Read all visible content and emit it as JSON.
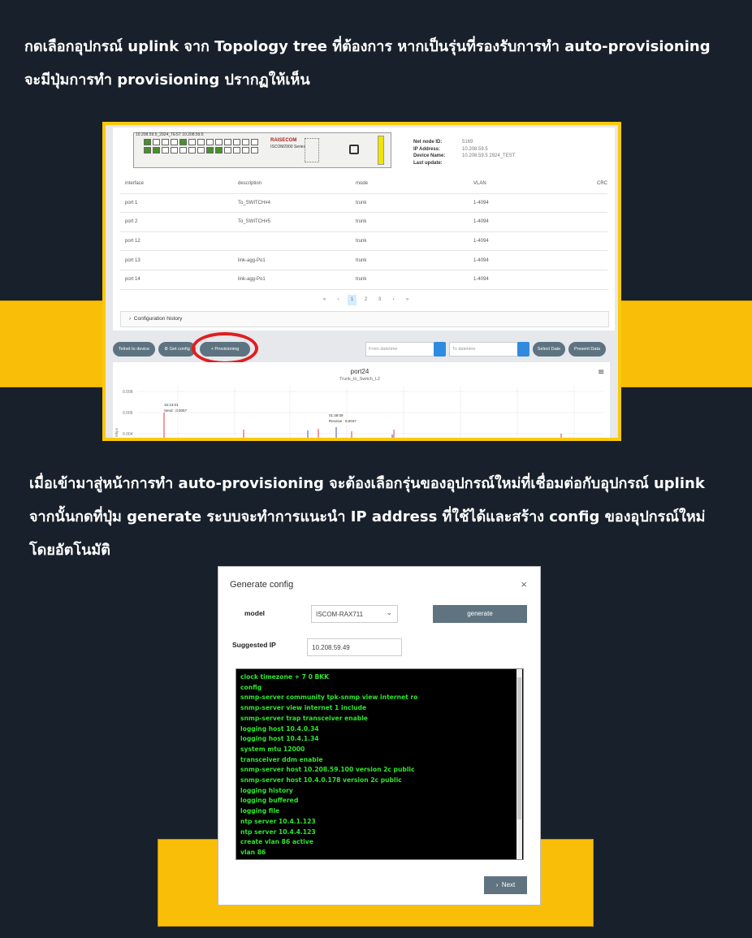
{
  "paragraph1": {
    "line1": "กดเลือกอุปกรณ์ uplink จาก Topology tree ที่ต้องการ หากเป็นรุ่นที่รองรับการทำ auto-provisioning",
    "line2": "จะมีปุ่มการทำ provisioning ปรากฏให้เห็น"
  },
  "paragraph2": {
    "line1": "เมื่อเข้ามาสู่หน้าการทำ auto-provisioning จะต้องเลือกรุ่นของอุปกรณ์ใหม่ที่เชื่อมต่อกับอุปกรณ์ uplink",
    "line2": "จากนั้นกดที่ปุ่ม generate ระบบจะทำการแนะนำ IP address ที่ใช้ได้และสร้าง config ของอุปกรณ์ใหม่",
    "line3": "โดยอัตโนมัติ"
  },
  "colors": {
    "background": "#18202b",
    "band": "#f9be08",
    "highlight_circle": "#e01e1e",
    "terminal_text": "#2fe52f",
    "button": "#5f7480"
  },
  "screenshot1": {
    "device_label": "10.208.59.5_2924_TEST 10.208.59.5",
    "brand": "RAISECOM",
    "series": "ISCOM2900 Series",
    "info": [
      {
        "key": "Net node ID:",
        "value": "5169"
      },
      {
        "key": "IP Address:",
        "value": "10.208.59.5"
      },
      {
        "key": "Device Name:",
        "value": "10.208.59.5 2924_TEST"
      },
      {
        "key": "Last update:",
        "value": ""
      }
    ],
    "table": {
      "headers": [
        "interface",
        "description",
        "mode",
        "VLAN",
        "CRC"
      ],
      "rows": [
        [
          "port 1",
          "To_SWITCH#4",
          "trunk",
          "1-4094",
          ""
        ],
        [
          "port 2",
          "To_SWITCH#5",
          "trunk",
          "1-4094",
          ""
        ],
        [
          "port 12",
          "",
          "trunk",
          "1-4094",
          ""
        ],
        [
          "port 13",
          "link-agg-Po1",
          "trunk",
          "1-4094",
          ""
        ],
        [
          "port 14",
          "link-agg-Po1",
          "trunk",
          "1-4094",
          ""
        ]
      ]
    },
    "pager": [
      "«",
      "‹",
      "1",
      "2",
      "3",
      "›",
      "»"
    ],
    "config_history": "Configuration history",
    "buttons": {
      "telnet": "Telnet to device",
      "get_config": "Get config",
      "provisioning": "+ Provisioning",
      "select_date": "Select Date",
      "present_data": "Present Data"
    },
    "from_placeholder": "From datetime",
    "to_placeholder": "To datetime",
    "chart": {
      "title": "port24",
      "subtitle": "Trunk_to_Switch_L2",
      "yticks": [
        "0.008",
        "0.006",
        "0.004"
      ],
      "ylabel": "Mbps",
      "tooltip1": {
        "time": "16:13:01",
        "text": "Send : 0.0057"
      },
      "tooltip2": {
        "time": "01:48:09",
        "text": "Receive : 0.0047"
      }
    }
  },
  "screenshot2": {
    "title": "Generate config",
    "close": "×",
    "model_label": "model",
    "model_value": "ISCOM-RAX711",
    "generate_label": "generate",
    "ip_label": "Suggested IP",
    "ip_value": "10.208.59.49",
    "config_lines": [
      "clock timezone + 7 0 BKK",
      "config",
      "snmp-server community tpk-snmp view internet ro",
      "snmp-server view internet 1 include",
      "snmp-server trap transceiver enable",
      "logging host 10.4.0.34",
      "logging host 10.4.1.34",
      "system mtu 12000",
      "transceiver ddm enable",
      "snmp-server host 10.208.59.100 version 2c public",
      "snmp-server host 10.4.0.178 version 2c public",
      "logging history",
      "logging buffered",
      "logging file",
      "ntp server 10.4.1.123",
      "ntp server 10.4.4.123",
      "create vlan 86 active",
      "vlan 86"
    ],
    "next_label": "Next"
  }
}
